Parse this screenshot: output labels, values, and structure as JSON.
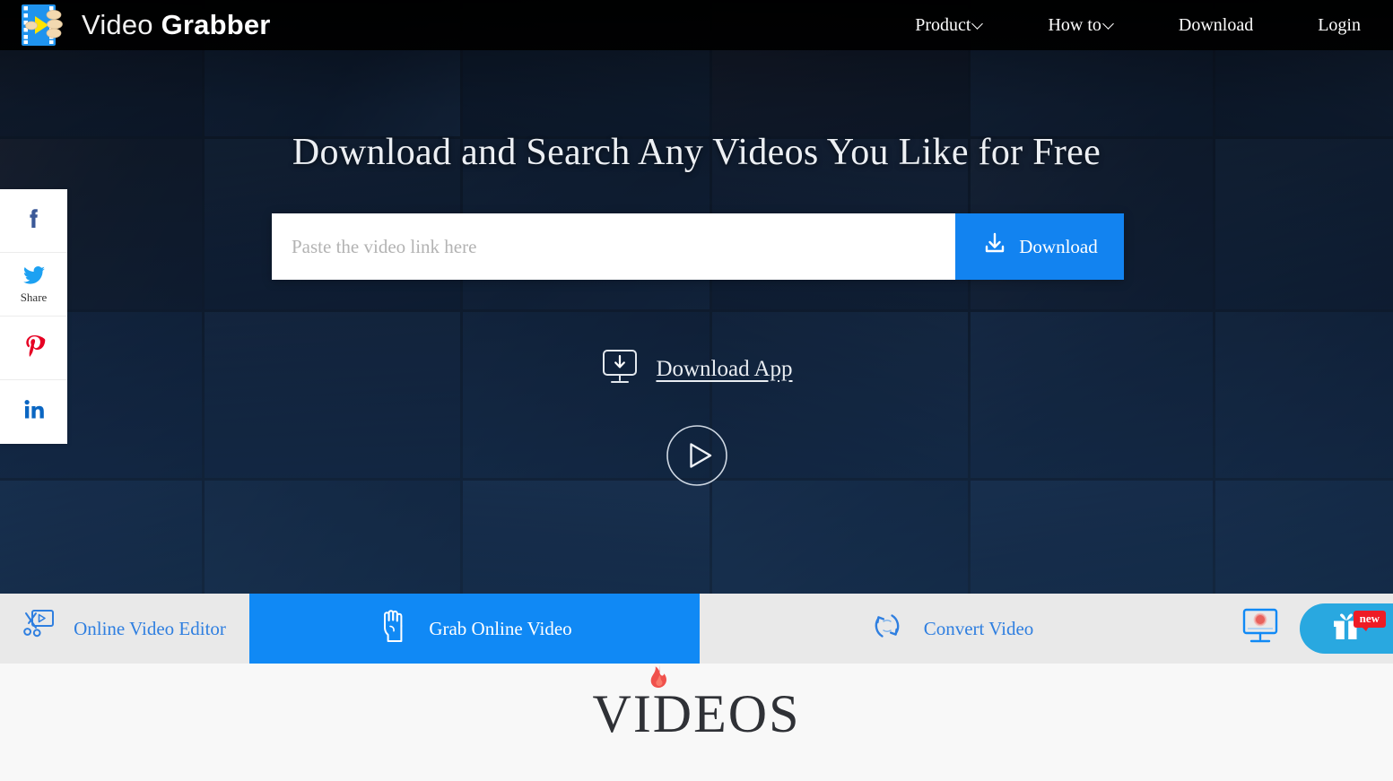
{
  "header": {
    "brand": {
      "light": "Video",
      "bold": "Grabber",
      "logo_icon": "film-strip-hand-logo"
    },
    "nav": [
      {
        "label": "Product",
        "icon": "chevron-down-icon",
        "has_caret": true
      },
      {
        "label": "How to",
        "icon": "chevron-down-icon",
        "has_caret": true
      },
      {
        "label": "Download",
        "icon": "",
        "has_caret": false
      },
      {
        "label": "Login",
        "icon": "",
        "has_caret": false
      }
    ]
  },
  "hero": {
    "title": "Download and Search Any Videos You Like for Free",
    "search": {
      "placeholder": "Paste the video link here",
      "value": "",
      "button_label": "Download",
      "button_icon": "download-tray-icon",
      "button_color": "#1283f0"
    },
    "app_link": {
      "label": "Download App",
      "icon": "desktop-download-icon"
    },
    "play_button": {
      "icon": "play-circle-icon"
    }
  },
  "social": [
    {
      "name": "facebook",
      "glyph": "f",
      "color": "#3b5998",
      "caption": ""
    },
    {
      "name": "twitter",
      "glyph": "",
      "color": "#1da1f2",
      "caption": "Share"
    },
    {
      "name": "pinterest",
      "glyph": "P",
      "color": "#e60023",
      "caption": ""
    },
    {
      "name": "linkedin",
      "glyph": "in",
      "color": "#0a66c2",
      "caption": ""
    }
  ],
  "tabs": [
    {
      "label": "Online Video Editor",
      "icon": "scissors-screen-icon",
      "active": false
    },
    {
      "label": "Grab Online Video",
      "icon": "grab-hand-icon",
      "active": true
    },
    {
      "label": "Convert Video",
      "icon": "convert-refresh-icon",
      "active": false
    }
  ],
  "tab_extras": {
    "recorder": {
      "icon": "screen-recorder-icon",
      "color": "#1089f5",
      "dot_color": "#e8615c"
    },
    "gift": {
      "icon": "gift-icon",
      "badge": "new",
      "badge_color": "#ee1c25",
      "color": "#29a8e0"
    }
  },
  "footer": {
    "logo_word": "VIDEOS",
    "logo_flame_icon": "flame-icon",
    "flame_color": "#f0514c"
  },
  "theme": {
    "accent_blue": "#1089f5",
    "header_bg": "#000000",
    "tabbar_bg": "#e9e9e9",
    "page_bg": "#f8f8f8"
  }
}
